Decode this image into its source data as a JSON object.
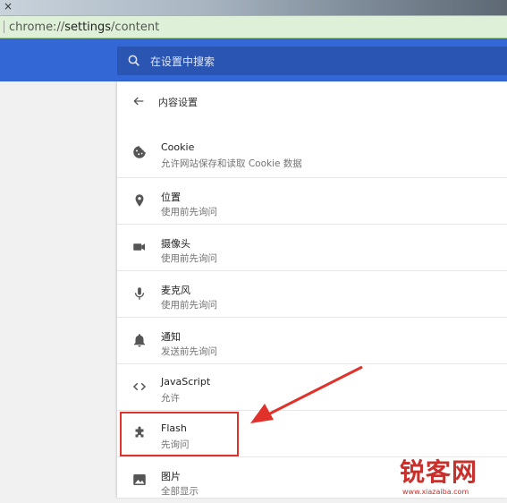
{
  "window": {
    "close_glyph": "×"
  },
  "address_bar": {
    "prefix": "chrome://",
    "host": "settings",
    "path": "/content"
  },
  "search": {
    "placeholder": "在设置中搜索",
    "icon": "search-icon"
  },
  "page": {
    "title": "内容设置",
    "back_icon": "arrow-left-icon"
  },
  "rows": [
    {
      "title": "Cookie",
      "subtitle": "允许网站保存和读取 Cookie 数据",
      "icon": "cookie-icon"
    },
    {
      "title": "位置",
      "subtitle": "使用前先询问",
      "icon": "location-pin-icon"
    },
    {
      "title": "摄像头",
      "subtitle": "使用前先询问",
      "icon": "camera-icon"
    },
    {
      "title": "麦克风",
      "subtitle": "使用前先询问",
      "icon": "microphone-icon"
    },
    {
      "title": "通知",
      "subtitle": "发送前先询问",
      "icon": "bell-icon"
    },
    {
      "title": "JavaScript",
      "subtitle": "允许",
      "icon": "code-icon"
    },
    {
      "title": "Flash",
      "subtitle": "先询问",
      "icon": "puzzle-icon"
    },
    {
      "title": "图片",
      "subtitle": "全部显示",
      "icon": "image-icon"
    }
  ],
  "watermark": {
    "text": "锐客网",
    "url": "www.xiazaiba.com"
  },
  "colors": {
    "header": "#3367d6",
    "search": "#2a55b3",
    "annotation": "#e0322b",
    "icon": "#555555"
  }
}
